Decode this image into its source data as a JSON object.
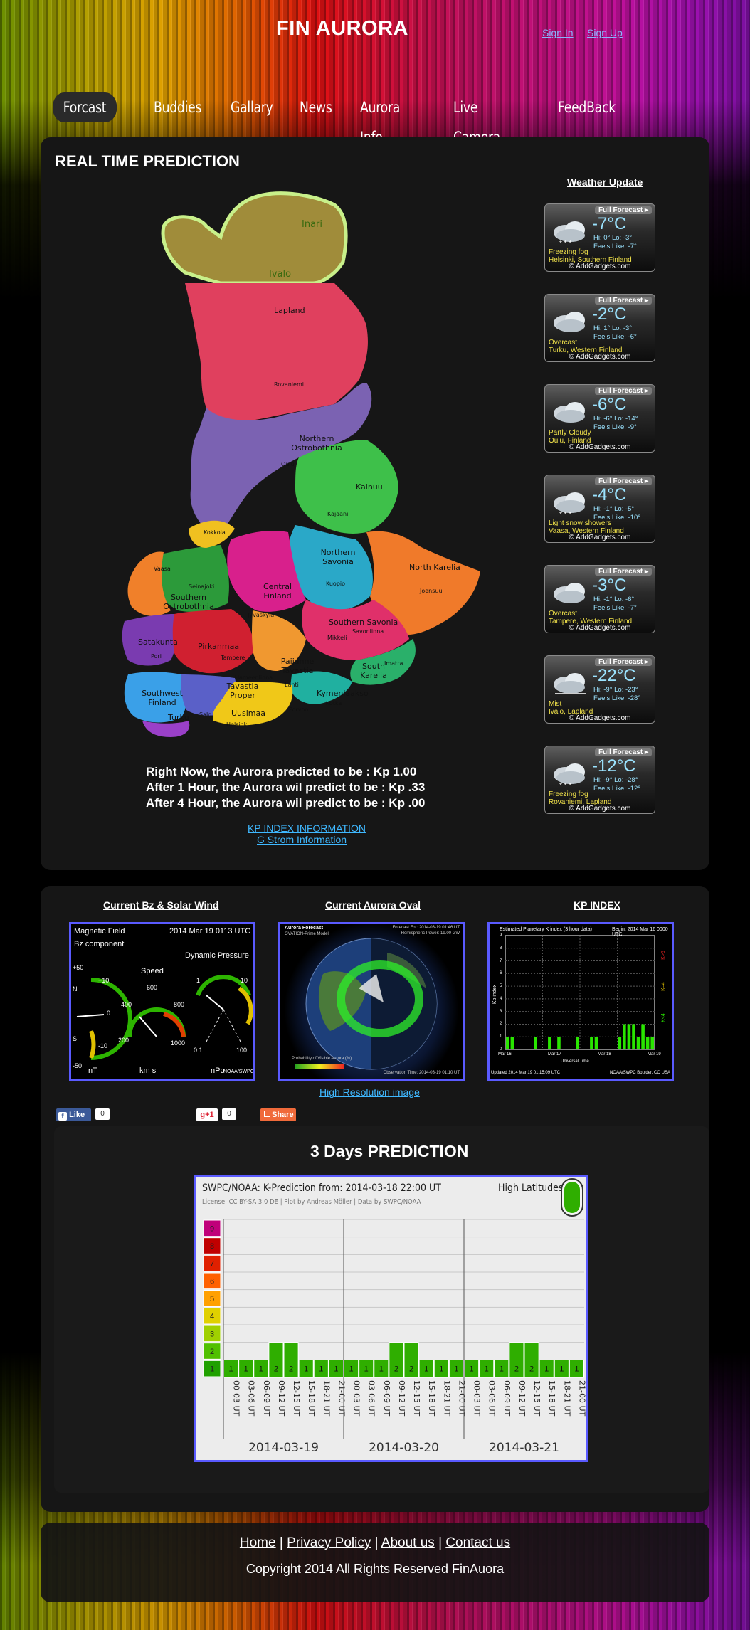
{
  "header": {
    "logo": "FIN AURORA",
    "sign_in": "Sign In",
    "sign_up": "Sign Up"
  },
  "nav": [
    "Forcast",
    "Buddies",
    "Gallary",
    "News",
    "Aurora Info",
    "Live Camera",
    "FeedBack"
  ],
  "realtime": {
    "title": "REAL TIME PREDICTION",
    "map_labels": [
      "Inari",
      "Ivalo",
      "Lapland",
      "Rovaniemi",
      "Northern Ostrobothnia",
      "Oulu",
      "Kainuu",
      "Kajaani",
      "Kokkola",
      "Northern Savonia",
      "Kuopio",
      "North Karelia",
      "Joensuu",
      "Vaasa",
      "Seinajoki",
      "Southern Ostrobothnia",
      "Central Finland",
      "Jyvaskyla",
      "Southern Savonia",
      "Mikkeli",
      "Savonlinna",
      "Satakunta",
      "Pori",
      "Pirkanmaa",
      "Tampere",
      "Paijanne Tavastia",
      "South Karelia",
      "Imatra",
      "Hameenlinna",
      "Lahti",
      "Southwest Finland",
      "Tavastia Proper",
      "Kymenlaakso",
      "Kotka",
      "Turku",
      "Salo",
      "Uusimaa",
      "Porvoo",
      "Helsinki"
    ],
    "predictions": [
      "Right Now, the Aurora predicted to be : Kp 1.00",
      "After 1 Hour, the Aurora wil predict to be : Kp .33",
      "After 4 Hour, the Aurora wil predict to be : Kp .00"
    ],
    "kp_link": "KP INDEX INFORMATION",
    "storm_link": "G Strom Information"
  },
  "weather": {
    "title": "Weather Update",
    "full_forecast": "Full Forecast ▸",
    "source": "© AddGadgets.com",
    "items": [
      {
        "temp": "-7°C",
        "hilo": "Hi: 0°    Lo: -3°",
        "feels": "Feels Like: -7°",
        "cond": "Freezing fog",
        "place": "Helsinki, Southern Finland",
        "icon": "fog-snow-icon"
      },
      {
        "temp": "-2°C",
        "hilo": "Hi: 1°    Lo: -3°",
        "feels": "Feels Like: -6°",
        "cond": "Overcast",
        "place": "Turku, Western Finland",
        "icon": "cloud-icon"
      },
      {
        "temp": "-6°C",
        "hilo": "Hi: -6°   Lo: -14°",
        "feels": "Feels Like: -9°",
        "cond": "Partly Cloudy",
        "place": "Oulu, Finland",
        "icon": "cloud-icon"
      },
      {
        "temp": "-4°C",
        "hilo": "Hi: -1°   Lo: -5°",
        "feels": "Feels Like: -10°",
        "cond": "Light snow showers",
        "place": "Vaasa, Western Finland",
        "icon": "snow-icon"
      },
      {
        "temp": "-3°C",
        "hilo": "Hi: -1°   Lo: -6°",
        "feels": "Feels Like: -7°",
        "cond": "Overcast",
        "place": "Tampere, Western Finland",
        "icon": "cloud-icon"
      },
      {
        "temp": "-22°C",
        "hilo": "Hi: -9°   Lo: -23°",
        "feels": "Feels Like: -28°",
        "cond": "Mist",
        "place": "Ivalo, Lapland",
        "icon": "mist-icon"
      },
      {
        "temp": "-12°C",
        "hilo": "Hi: -9°   Lo: -28°",
        "feels": "Feels Like: -12°",
        "cond": "Freezing fog",
        "place": "Rovaniemi, Lapland",
        "icon": "fog-snow-icon"
      }
    ]
  },
  "panels": {
    "bz_title": "Current Bz & Solar Wind",
    "oval_title": "Current Aurora Oval",
    "kp_title": "KP INDEX",
    "hires_link": "High Resolution image"
  },
  "bz_image": {
    "title": "Magnetic Field",
    "bz": "Bz component",
    "date": "2014 Mar 19 0113 UTC",
    "speed": "Speed",
    "dp": "Dynamic Pressure",
    "nt": "nT",
    "kms": "km s",
    "npo": "nPo",
    "noaa": "NOAA/SWPC",
    "s_label": "S",
    "n_label": "N",
    "ticks_bz": [
      "+50",
      "+10",
      "0",
      "-10",
      "-50"
    ],
    "ticks_speed": [
      "200",
      "400",
      "600",
      "800",
      "1000"
    ],
    "ticks_dp": [
      "0.1",
      "1",
      "10",
      "100"
    ]
  },
  "oval_image": {
    "title": "Aurora Forecast",
    "model": "OVATION-Prime Model",
    "forecast": "Forecast For: 2014-03-19 01:46 UT",
    "hemisphere": "Hemispheric Power: 19.00 GW",
    "obs": "Observation Time: 2014-03-19 01:10 UT",
    "prob": "Probability of Visible Aurora (%)"
  },
  "kp_image": {
    "title": "Estimated Planetary K index (3 hour data)",
    "begin": "Begin: 2014 Mar 16 0000 UTC",
    "ylabel": "Kp index",
    "xlabel": "Universal Time",
    "updated": "Updated 2014 Mar 19 01:15:09 UTC",
    "credit": "NOAA/SWPC Boulder, CO USA",
    "x_ticks": [
      "Mar 16",
      "Mar 17",
      "Mar 18",
      "Mar 19"
    ],
    "y_ticks": [
      "9",
      "8",
      "7",
      "6",
      "5",
      "4",
      "3",
      "2",
      "1",
      "0"
    ],
    "right_labels": [
      "K>5",
      "K=4",
      "K<4"
    ]
  },
  "social": {
    "like": "Like",
    "like_count": "0",
    "gplus": "+1",
    "gplus_count": "0",
    "share": "Share"
  },
  "prediction3": {
    "title": "3 Days PREDICTION",
    "heading": "SWPC/NOAA: K-Prediction from: 2014-03-18 22:00 UT",
    "latitudes": "High Latitudes",
    "license": "License: CC BY-SA 3.0 DE | Plot by Andreas Möller | Data by SWPC/NOAA"
  },
  "chart_data": {
    "type": "bar",
    "title": "SWPC/NOAA: K-Prediction from: 2014-03-18 22:00 UT",
    "subtitle": "High Latitudes",
    "categories": [
      "00-03 UT",
      "03-06 UT",
      "06-09 UT",
      "09-12 UT",
      "12-15 UT",
      "15-18 UT",
      "18-21 UT",
      "21-00 UT",
      "00-03 UT",
      "03-06 UT",
      "06-09 UT",
      "09-12 UT",
      "12-15 UT",
      "15-18 UT",
      "18-21 UT",
      "21-00 UT",
      "00-03 UT",
      "03-06 UT",
      "06-09 UT",
      "09-12 UT",
      "12-15 UT",
      "15-18 UT",
      "18-21 UT",
      "21-00 UT"
    ],
    "groups": [
      "2014-03-19",
      "2014-03-20",
      "2014-03-21"
    ],
    "values": [
      1,
      1,
      1,
      2,
      2,
      1,
      1,
      1,
      1,
      1,
      1,
      2,
      2,
      1,
      1,
      1,
      1,
      1,
      1,
      2,
      2,
      1,
      1,
      1
    ],
    "ylim": [
      0,
      9
    ],
    "scale_labels": [
      "9",
      "8",
      "7",
      "6",
      "5",
      "4",
      "3",
      "2",
      "1"
    ],
    "scale_colors": [
      "#c0007a",
      "#c00000",
      "#e02000",
      "#ff6000",
      "#ffa000",
      "#e0d000",
      "#a0d000",
      "#50c000",
      "#20a000"
    ],
    "bar_color": "#2fae00"
  },
  "footer": {
    "home": "Home",
    "privacy": "Privacy Policy",
    "about": "About us",
    "contact": "Contact us",
    "sep": "|",
    "copyright": "Copyright 2014 All Rights Reserved FinAuora"
  }
}
